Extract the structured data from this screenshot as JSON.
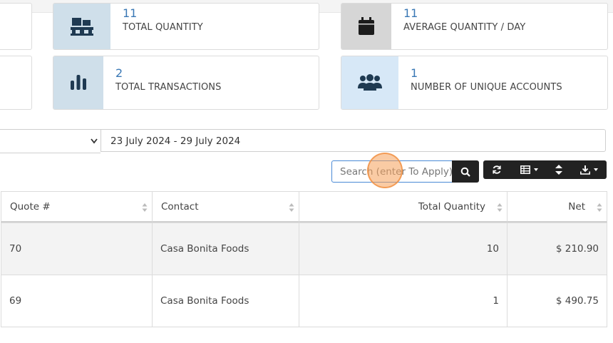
{
  "cards": [
    {
      "id": "total-quantity",
      "value": "11",
      "label": "TOTAL QUANTITY",
      "icon": "pallet-boxes-icon",
      "icon_bg": "#cfdfea",
      "icon_color": "#1f3a52"
    },
    {
      "id": "avg-quantity",
      "value": "11",
      "label": "AVERAGE QUANTITY / DAY",
      "icon": "calendar-icon",
      "icon_bg": "#d6d6d6",
      "icon_color": "#1c1c1c"
    },
    {
      "id": "total-transactions",
      "value": "2",
      "label": "TOTAL TRANSACTIONS",
      "icon": "bar-chart-icon",
      "icon_bg": "#cfdfea",
      "icon_color": "#1f3a52"
    },
    {
      "id": "unique-accounts",
      "value": "1",
      "label": "NUMBER OF UNIQUE ACCOUNTS",
      "icon": "users-icon",
      "icon_bg": "#d7e8f7",
      "icon_color": "#1f3a52"
    }
  ],
  "filters": {
    "date_range": "23 July 2024 - 29 July 2024"
  },
  "search": {
    "placeholder": "Search (enter To Apply)"
  },
  "toolbar": [
    "refresh-icon",
    "columns-icon",
    "sort-toggle-icon",
    "download-icon"
  ],
  "table": {
    "columns": [
      "Quote #",
      "Contact",
      "Total Quantity",
      "Net"
    ],
    "rows": [
      {
        "quote": "70",
        "contact": "Casa Bonita Foods",
        "qty": "10",
        "net": "$ 210.90"
      },
      {
        "quote": "69",
        "contact": "Casa Bonita Foods",
        "qty": "1",
        "net": "$ 490.75"
      }
    ]
  },
  "colors": {
    "accent": "#3a78b5",
    "dark_button": "#222222",
    "row_alt": "#f3f3f3"
  }
}
